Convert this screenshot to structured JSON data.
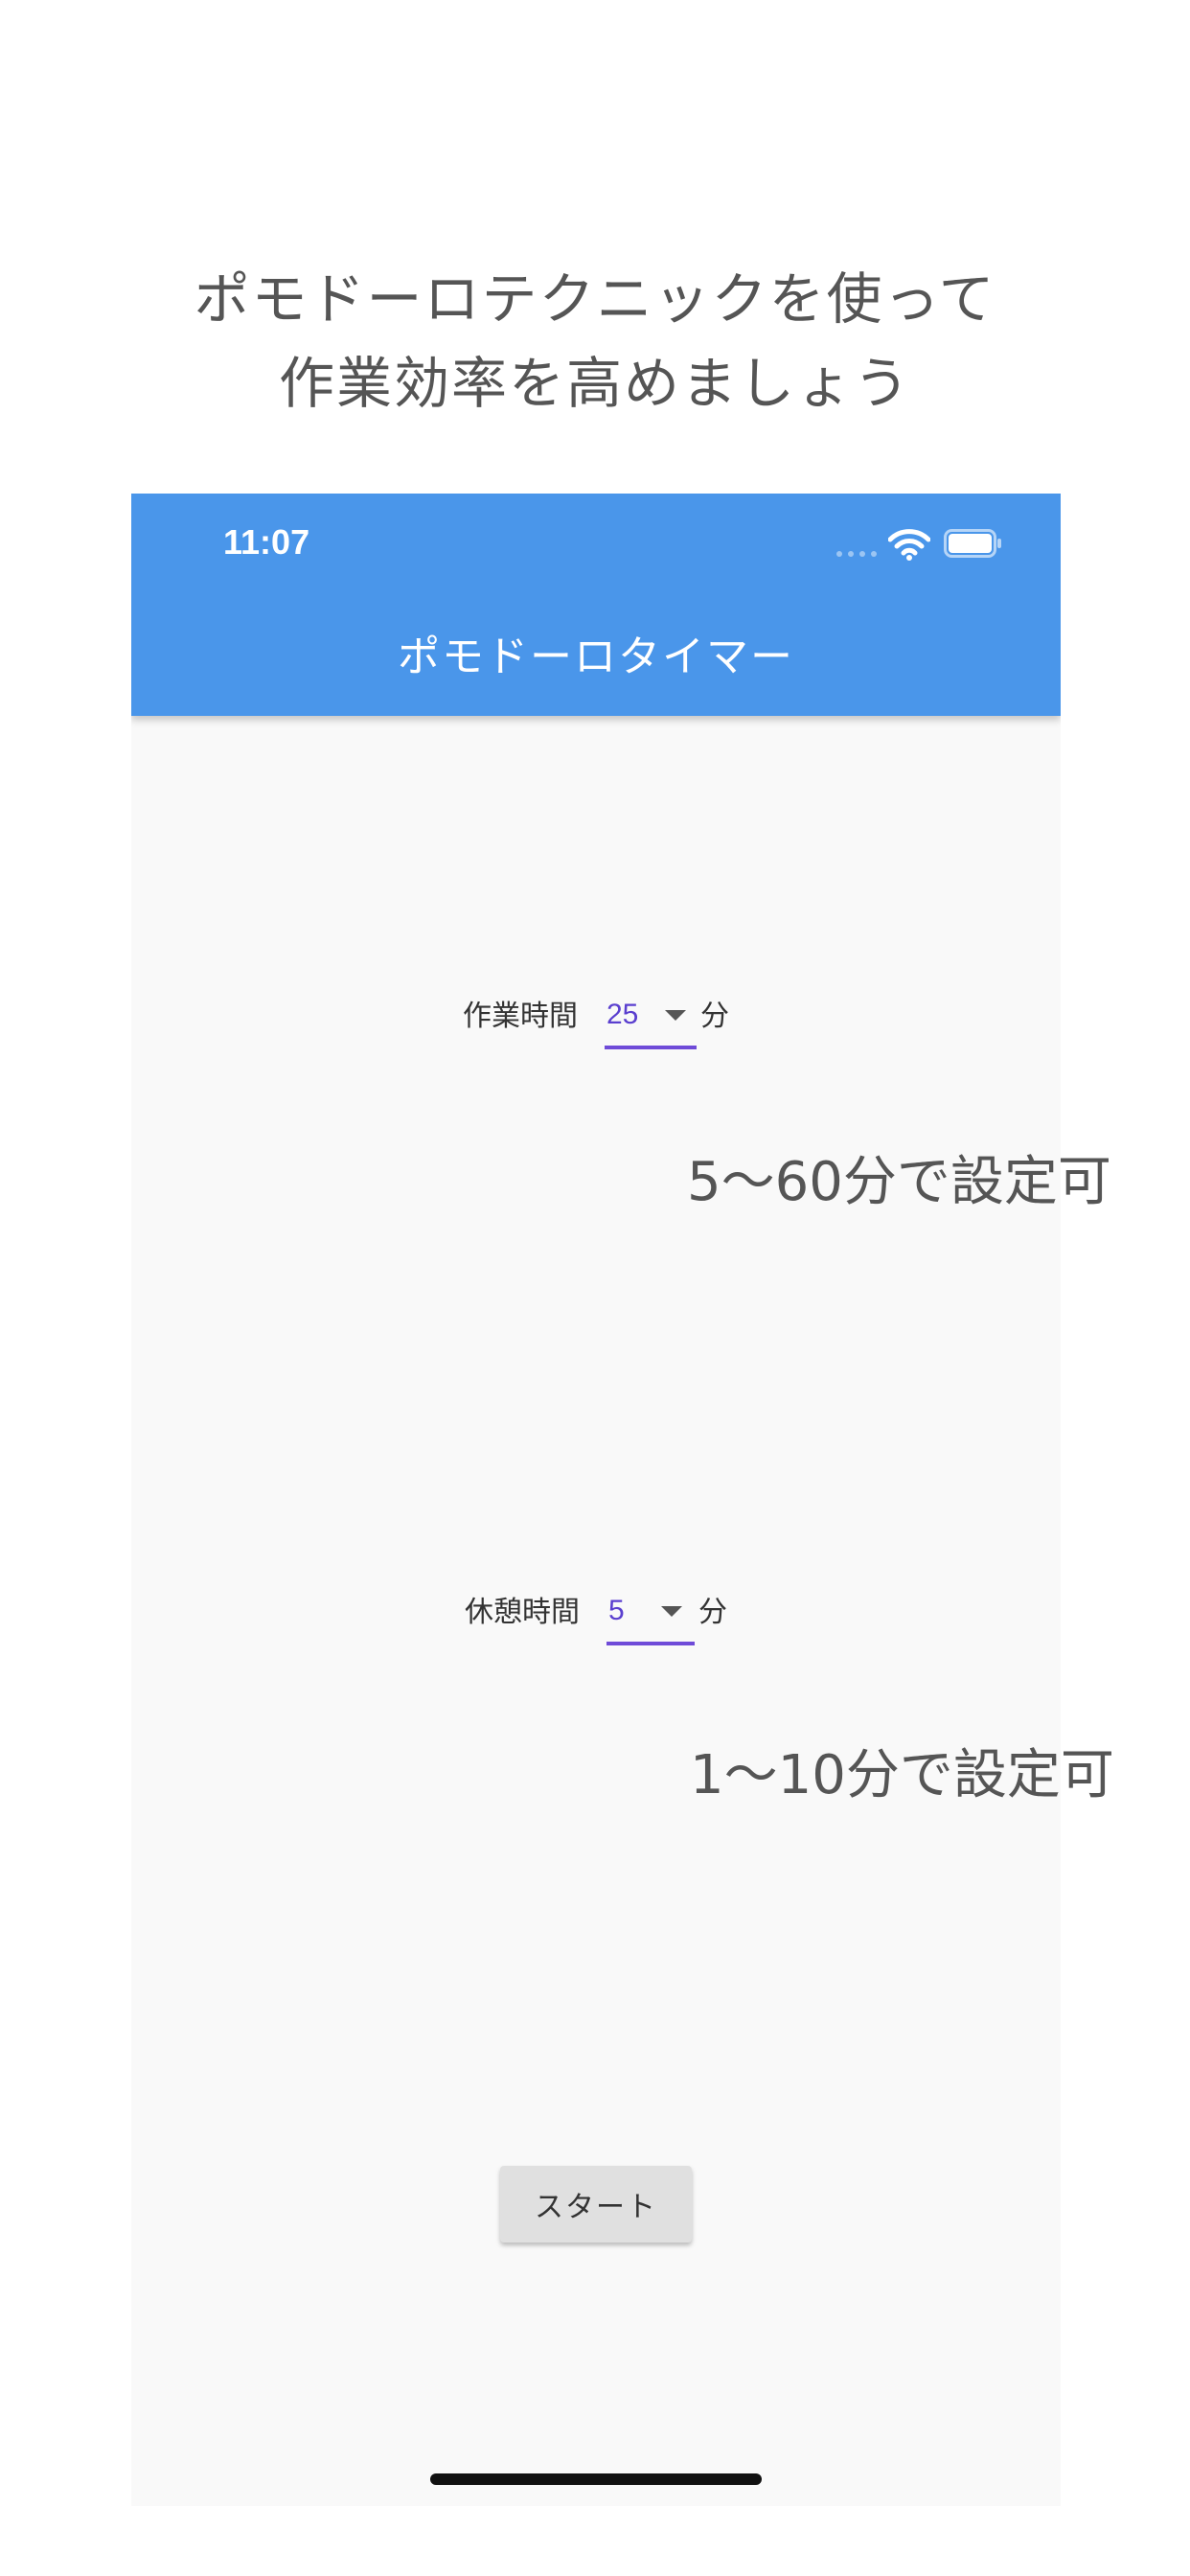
{
  "promo": {
    "headline_line1": "ポモドーロテクニックを使って",
    "headline_line2": "作業効率を高めましょう",
    "work_range_note": "5〜60分で設定可",
    "rest_range_note": "1〜10分で設定可"
  },
  "status_bar": {
    "time": "11:07",
    "icons": [
      "signal-icon",
      "wifi-icon",
      "battery-icon"
    ]
  },
  "app_bar": {
    "title": "ポモドーロタイマー",
    "color": "#4a96ea"
  },
  "work_time": {
    "label": "作業時間",
    "value": "25",
    "unit": "分"
  },
  "rest_time": {
    "label": "休憩時間",
    "value": "5",
    "unit": "分"
  },
  "start_button": {
    "label": "スタート"
  },
  "colors": {
    "accent": "#6f4bd8",
    "background": "#f9f9f9"
  }
}
